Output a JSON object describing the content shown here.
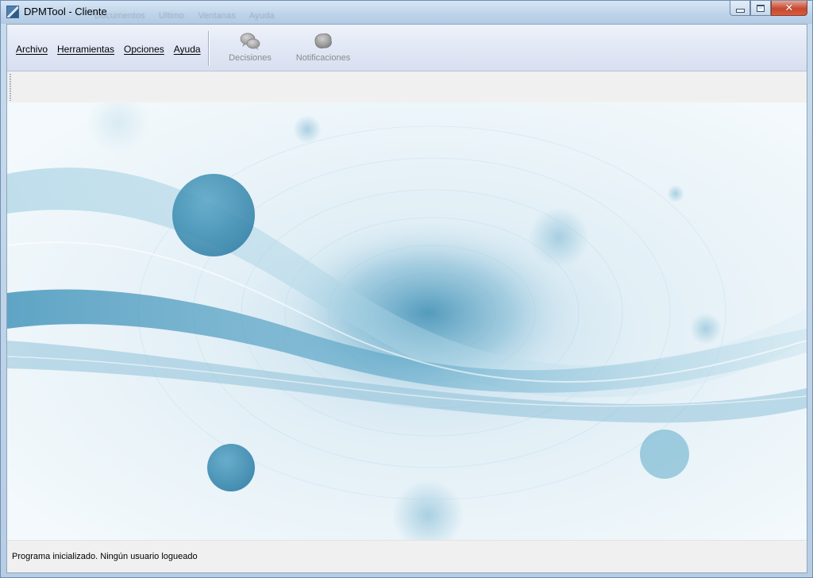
{
  "window": {
    "title": "DPMTool - Cliente",
    "ghost_menu": [
      "Documentos",
      "Ultimo",
      "Ventanas",
      "Ayuda"
    ],
    "accent": "#6d8fb3"
  },
  "menu": {
    "items": [
      {
        "label": "Archivo"
      },
      {
        "label": "Herramientas"
      },
      {
        "label": "Opciones"
      },
      {
        "label": "Ayuda"
      }
    ]
  },
  "ribbon": {
    "decisions": {
      "label": "Decisiones",
      "icon": "speech-bubbles-icon"
    },
    "notifications": {
      "label": "Notificaciones",
      "icon": "notification-blob-icon"
    }
  },
  "background": {
    "wave_color": "#3e8fb3",
    "dot_color": "#2f7ea6"
  },
  "status": {
    "text": "Programa inicializado. Ningún usuario logueado"
  }
}
